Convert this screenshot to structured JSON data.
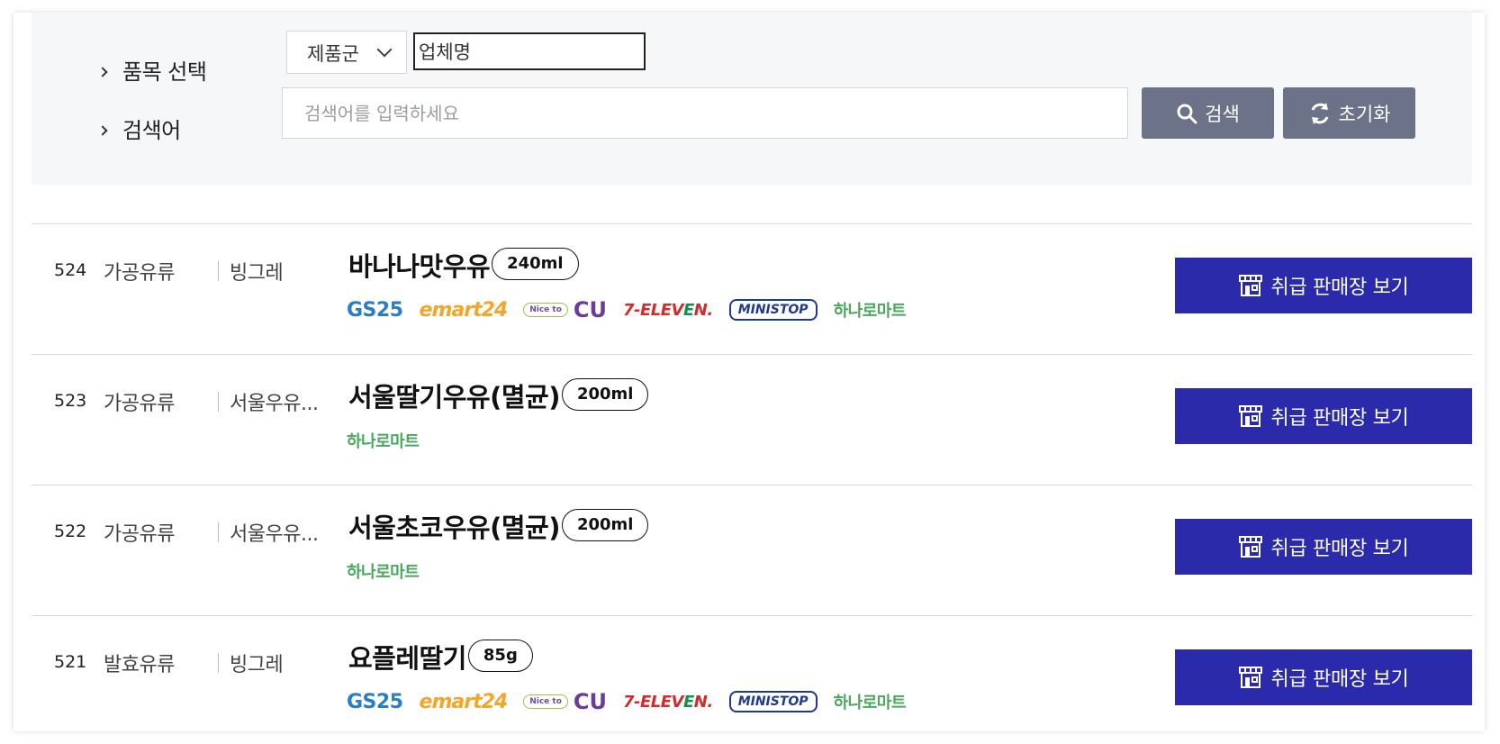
{
  "filter": {
    "item_label": "품목 선택",
    "keyword_label": "검색어",
    "select_value": "제품군",
    "company_value": "업체명",
    "keyword_placeholder": "검색어를 입력하세요",
    "search_label": "검색",
    "reset_label": "초기화"
  },
  "colors": {
    "panel_bg": "#f6f7f9",
    "filter_button": "#6c7389",
    "view_button": "#2a2aab"
  },
  "store_labels": {
    "gs25": "GS25",
    "emart24": "emart24",
    "nice_to": "Nice to",
    "cu": "CU",
    "seven_a": "7-ELEV",
    "seven_b": "E",
    "seven_c": "N.",
    "ministop": "MINISTOP",
    "hanaro": "하나로마트"
  },
  "products": [
    {
      "num": "524",
      "category": "가공유류",
      "maker": "빙그레",
      "name": "바나나맛우유",
      "size": "240ml",
      "stores": [
        "gs25",
        "emart24",
        "cu",
        "7eleven",
        "ministop",
        "hanaro"
      ],
      "button_label": "취급 판매장 보기"
    },
    {
      "num": "523",
      "category": "가공유류",
      "maker": "서울우유...",
      "name": "서울딸기우유(멸균)",
      "size": "200ml",
      "stores": [
        "hanaro"
      ],
      "button_label": "취급 판매장 보기"
    },
    {
      "num": "522",
      "category": "가공유류",
      "maker": "서울우유...",
      "name": "서울초코우유(멸균)",
      "size": "200ml",
      "stores": [
        "hanaro"
      ],
      "button_label": "취급 판매장 보기"
    },
    {
      "num": "521",
      "category": "발효유류",
      "maker": "빙그레",
      "name": "요플레딸기",
      "size": "85g",
      "stores": [
        "gs25",
        "emart24",
        "cu",
        "7eleven",
        "ministop",
        "hanaro"
      ],
      "button_label": "취급 판매장 보기"
    }
  ]
}
